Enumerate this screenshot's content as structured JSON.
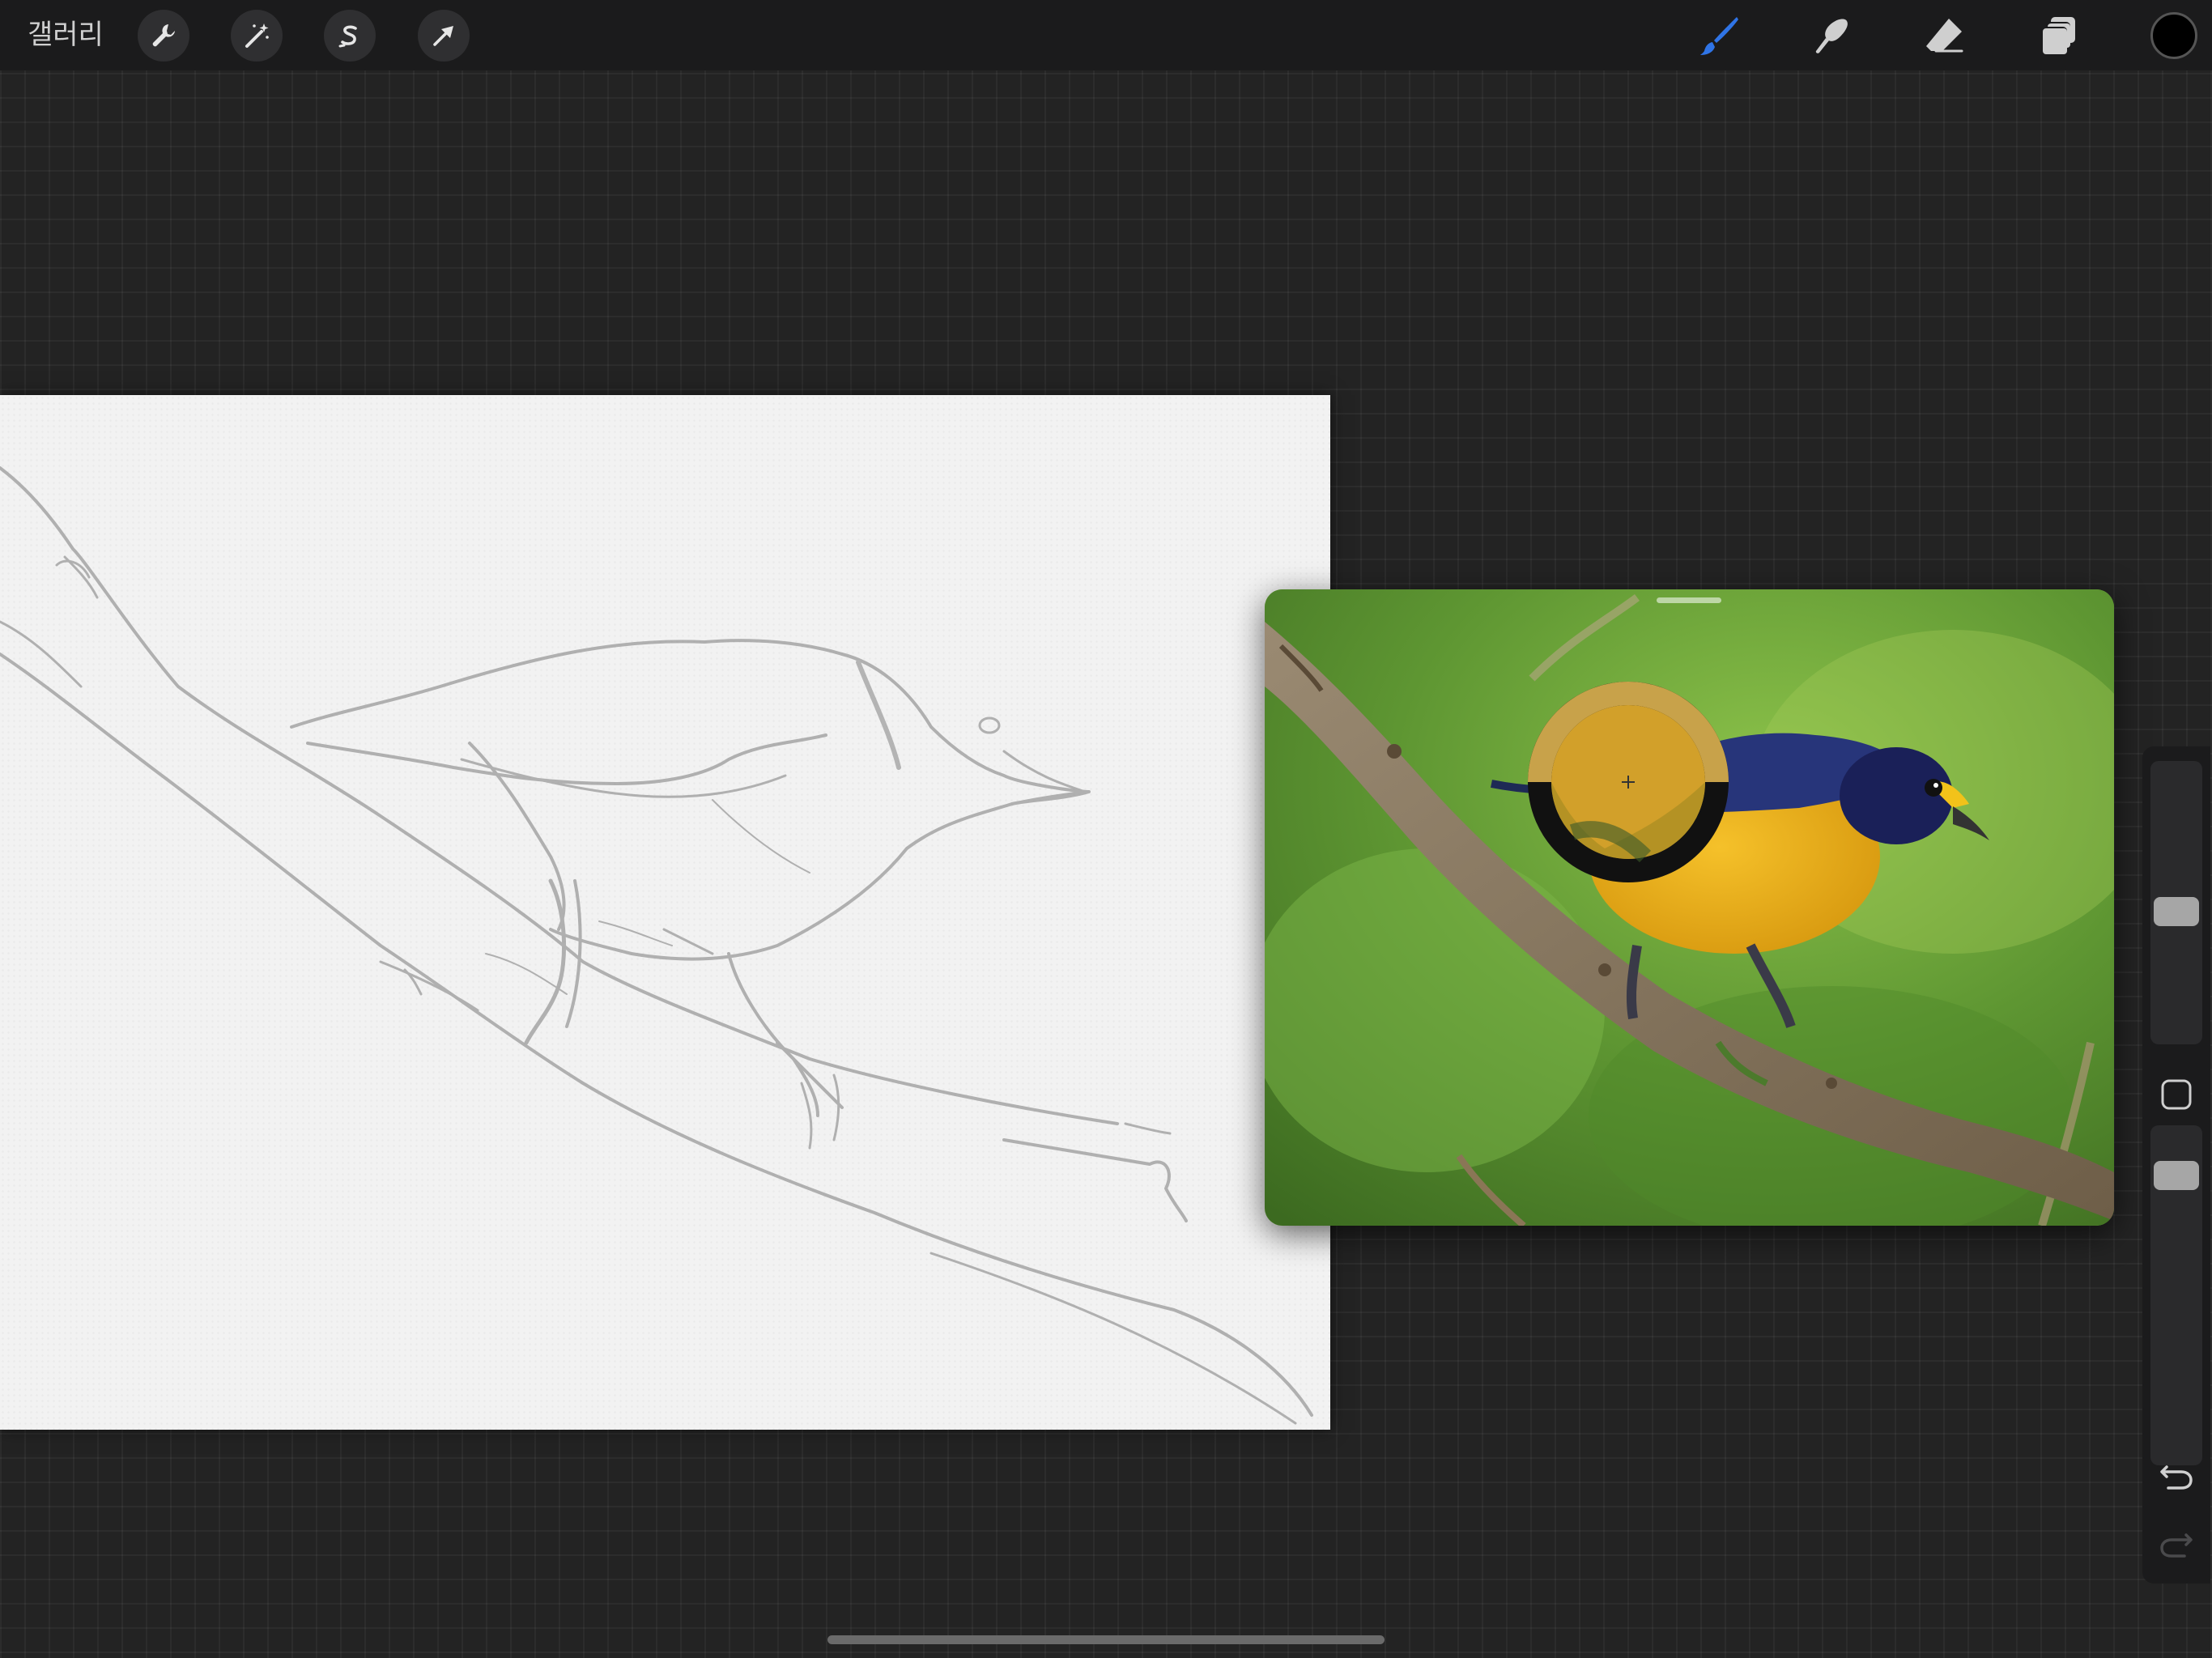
{
  "toolbar": {
    "gallery_label": "갤러리",
    "left_tools": [
      {
        "icon": "wrench-icon",
        "label": "actions"
      },
      {
        "icon": "magic-wand-icon",
        "label": "adjustments"
      },
      {
        "icon": "selection-s-icon",
        "label": "selection"
      },
      {
        "icon": "arrow-cursor-icon",
        "label": "transform"
      }
    ],
    "right_tools": [
      {
        "icon": "brush-icon",
        "active": true
      },
      {
        "icon": "smudge-icon",
        "active": false
      },
      {
        "icon": "eraser-icon",
        "active": false
      },
      {
        "icon": "layers-icon",
        "active": false
      }
    ],
    "current_color": "#000000",
    "active_tool_color": "#2f74e6"
  },
  "reference_window": {
    "eyedropper_sample_color": "#c8a24a"
  },
  "sidebar": {
    "brush_size_level": 0.5,
    "opacity_level": 0.9,
    "icons": [
      "modify-square-icon",
      "undo-icon",
      "redo-icon"
    ]
  }
}
